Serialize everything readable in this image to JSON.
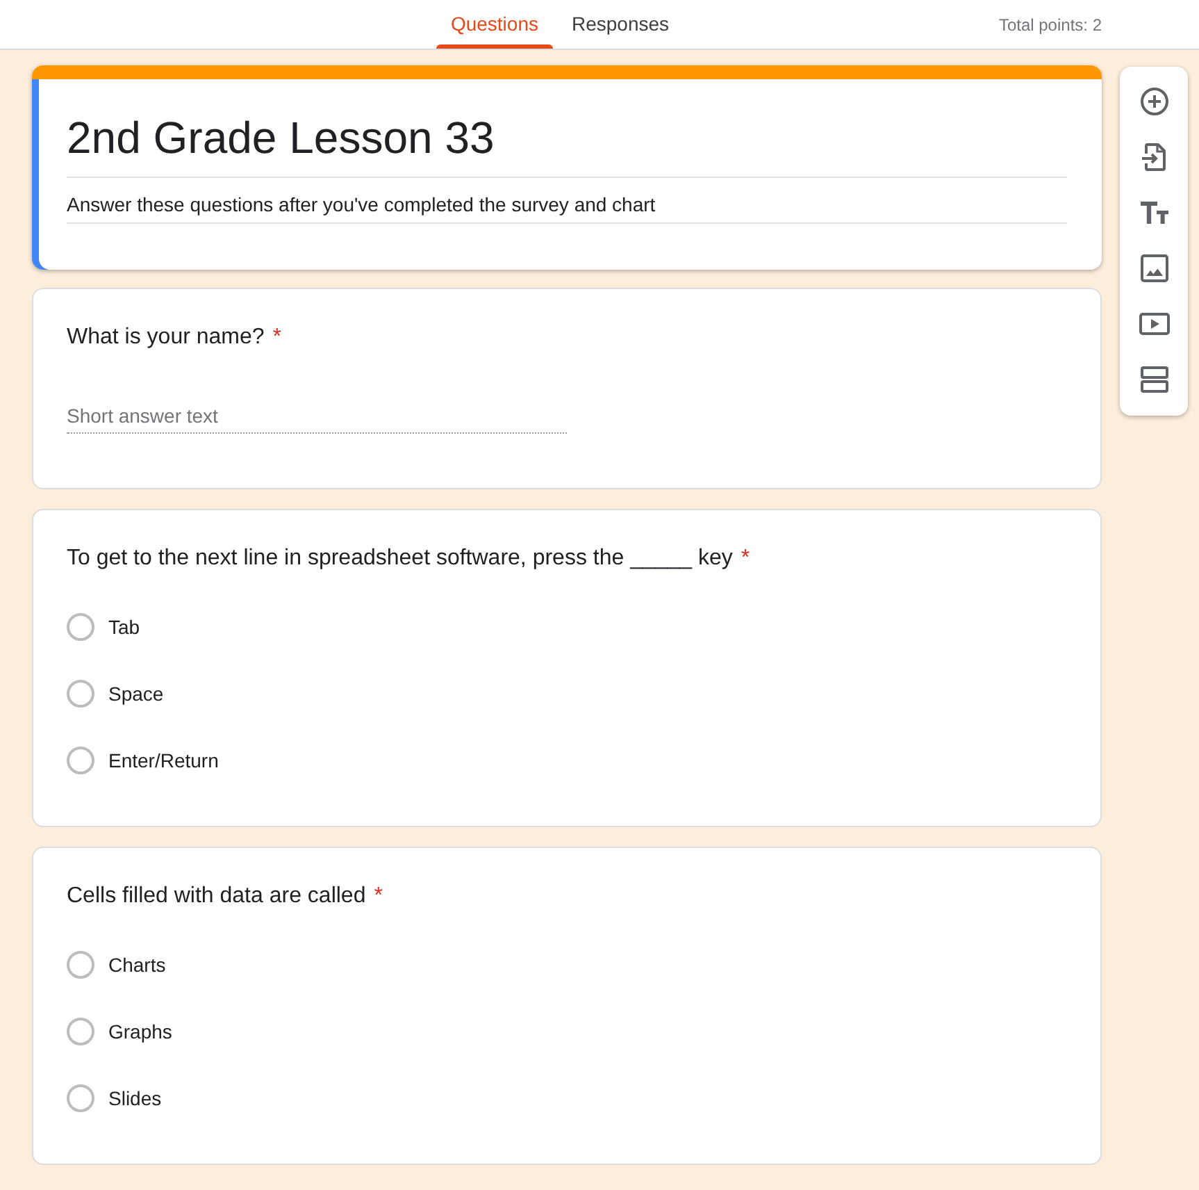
{
  "tabs": [
    {
      "label": "Questions",
      "selected": true
    },
    {
      "label": "Responses",
      "selected": false
    }
  ],
  "total_points": "Total points: 2",
  "form_header": {
    "title": "2nd Grade Lesson 33",
    "description": "Answer these questions after you've completed the survey and chart"
  },
  "questions": [
    {
      "kind": "short_answer",
      "title": "What is your name?",
      "required_mark": "*",
      "placeholder": "Short answer text"
    },
    {
      "kind": "multiple_choice",
      "title": "To get to the next line in spreadsheet software, press the _____ key",
      "required_mark": "*",
      "options": [
        {
          "label": "Tab",
          "selected": false
        },
        {
          "label": "Space",
          "selected": false
        },
        {
          "label": "Enter/Return",
          "selected": false
        }
      ]
    },
    {
      "kind": "multiple_choice",
      "title": "Cells filled with data are called",
      "required_mark": "*",
      "options": [
        {
          "label": "Charts",
          "selected": false
        },
        {
          "label": "Graphs",
          "selected": false
        },
        {
          "label": "Slides",
          "selected": false
        }
      ]
    }
  ]
}
